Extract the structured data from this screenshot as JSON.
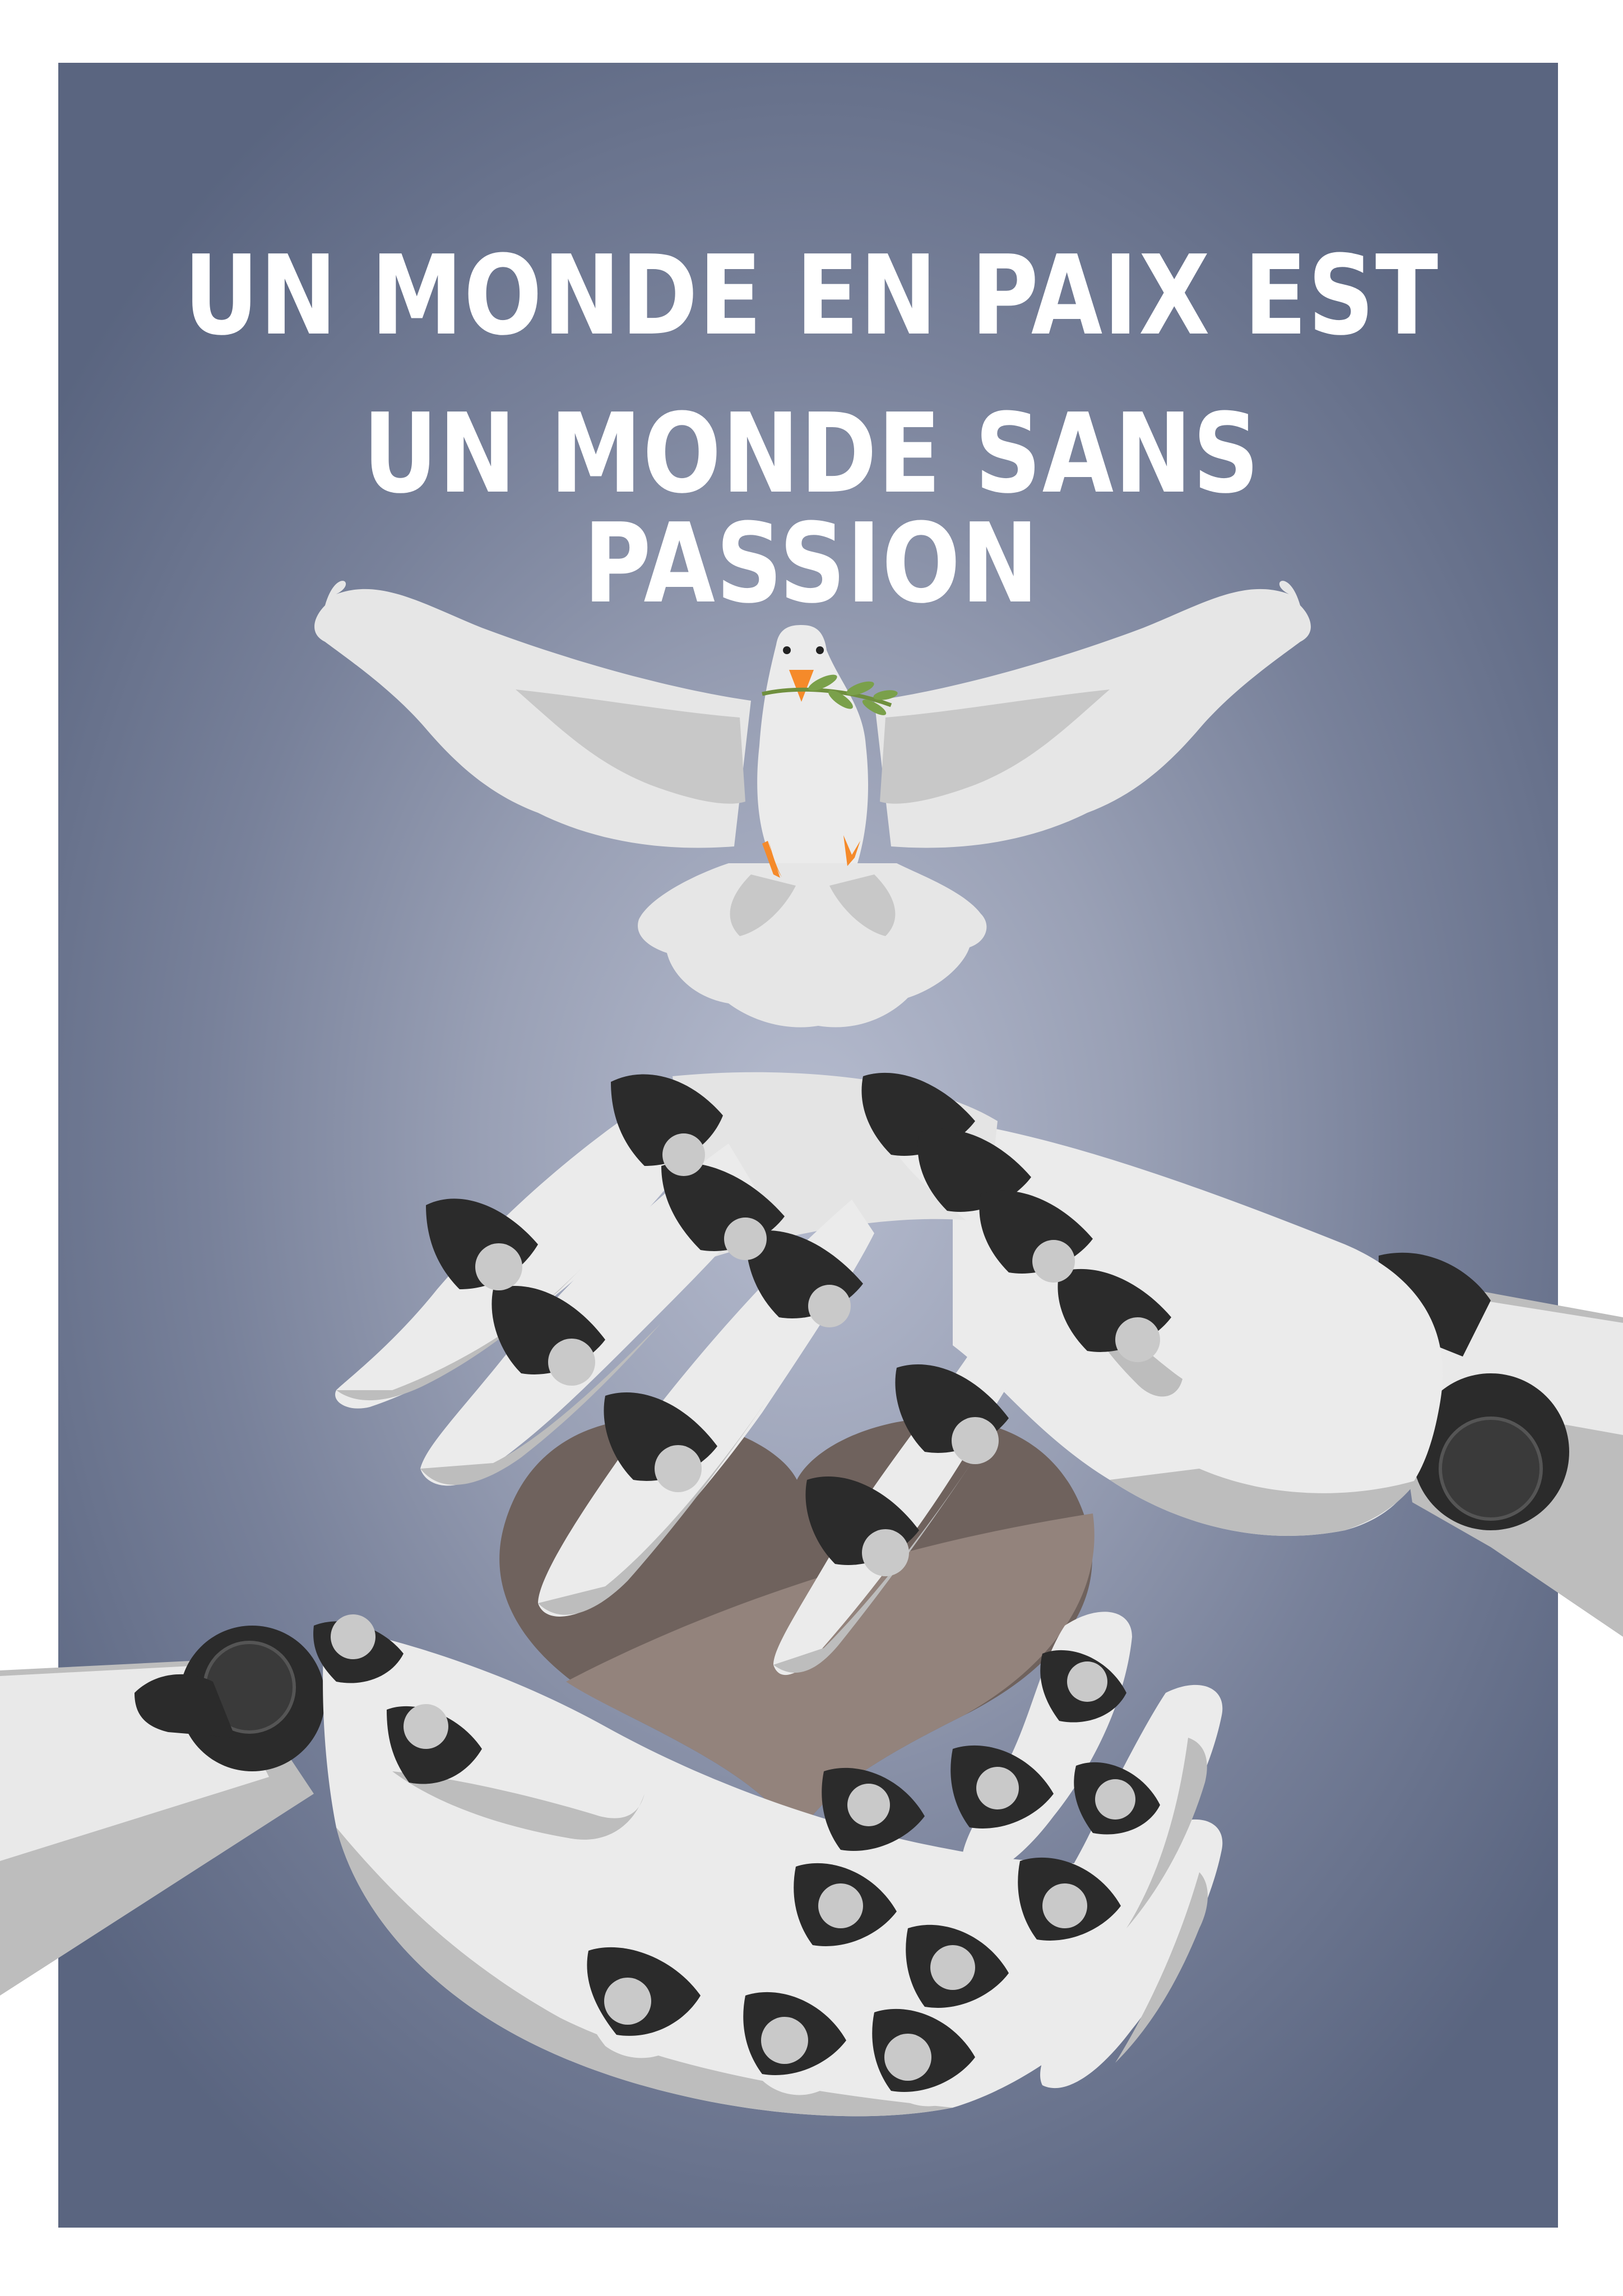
{
  "poster": {
    "headline_line1": "UN MONDE EN PAIX EST",
    "headline_line2": "UN MONDE SANS PASSION"
  },
  "colors": {
    "background_center": "#b6bccf",
    "background_edge": "#5a6580",
    "frame": "#ffffff",
    "text": "#ffffff",
    "dove": "#e6e6e6",
    "dove_shadow": "#c6c6c6",
    "beak_feet": "#f58a2a",
    "olive_branch": "#7aa04a",
    "heart_dark": "#6f625d",
    "heart_light": "#93837c",
    "robot_white": "#ebebeb",
    "robot_gray": "#bdbdbd",
    "robot_joint": "#2b2b2b"
  },
  "icons": {
    "dove": "dove-icon",
    "olive_branch": "olive-branch-icon",
    "heart": "heart-icon",
    "upper_robot_hand": "robot-hand-icon",
    "lower_robot_hand": "robot-hand-icon"
  }
}
